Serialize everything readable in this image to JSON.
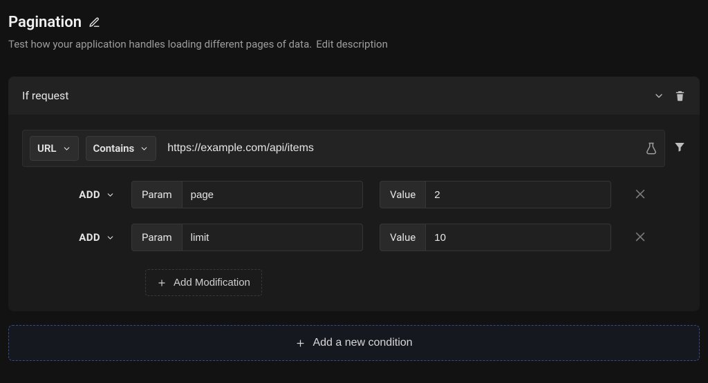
{
  "title": "Pagination",
  "subtitle": "Test how your application handles loading different pages of data.",
  "edit_description_label": "Edit description",
  "condition": {
    "header": "If request",
    "field": "URL",
    "operator": "Contains",
    "url_value": "https://example.com/api/items",
    "modifications": [
      {
        "action": "ADD",
        "param_label": "Param",
        "param_name": "page",
        "value_label": "Value",
        "value": "2"
      },
      {
        "action": "ADD",
        "param_label": "Param",
        "param_name": "limit",
        "value_label": "Value",
        "value": "10"
      }
    ],
    "add_modification_label": "Add Modification"
  },
  "add_condition_label": "Add a new condition"
}
